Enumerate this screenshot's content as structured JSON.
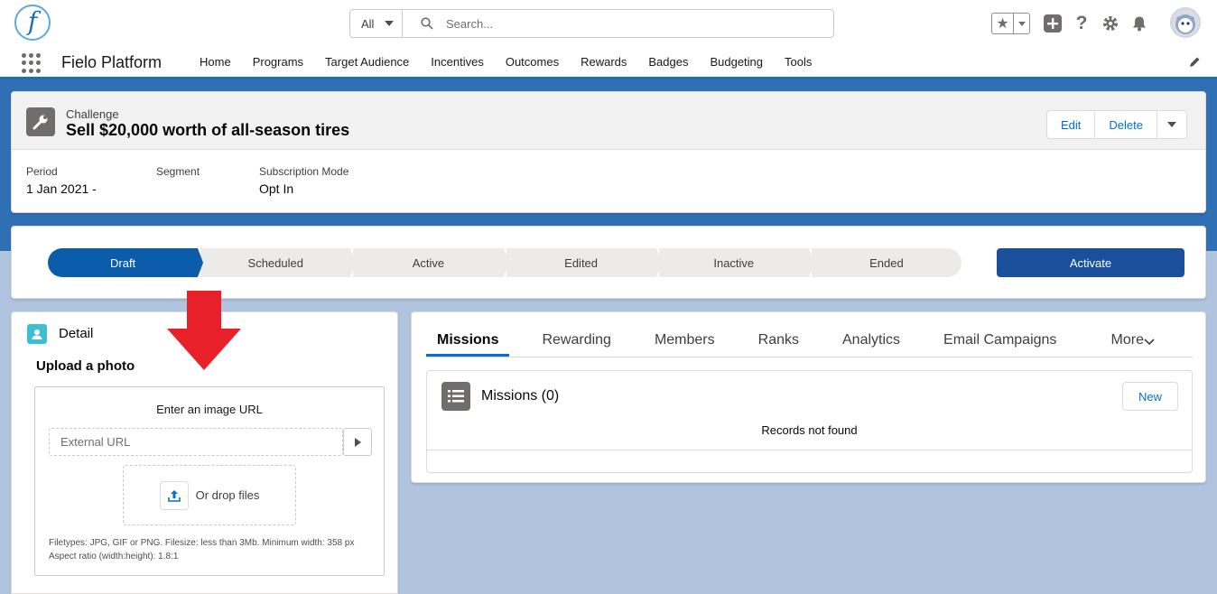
{
  "header": {
    "logo_letter": "f",
    "search": {
      "scope": "All",
      "placeholder": "Search..."
    }
  },
  "nav": {
    "app_name": "Fielo Platform",
    "items": [
      "Home",
      "Programs",
      "Target Audience",
      "Incentives",
      "Outcomes",
      "Rewards",
      "Badges",
      "Budgeting",
      "Tools"
    ]
  },
  "record": {
    "type": "Challenge",
    "title": "Sell $20,000 worth of all-season tires",
    "actions": {
      "edit": "Edit",
      "delete": "Delete"
    },
    "fields": [
      {
        "label": "Period",
        "value": "1 Jan 2021 -"
      },
      {
        "label": "Segment",
        "value": ""
      },
      {
        "label": "Subscription Mode",
        "value": "Opt In"
      }
    ]
  },
  "path": {
    "steps": [
      "Draft",
      "Scheduled",
      "Active",
      "Edited",
      "Inactive",
      "Ended"
    ],
    "current": "Draft",
    "action": "Activate"
  },
  "detail": {
    "title": "Detail",
    "upload_title": "Upload a photo",
    "enter_url": "Enter an image URL",
    "url_placeholder": "External URL",
    "drop_label": "Or drop files",
    "hint_line1": "Filetypes: JPG, GIF or PNG. Filesize: less than 3Mb. Minimum width: 358 px",
    "hint_line2": "Aspect ratio (width:height): 1.8:1"
  },
  "tabs": {
    "items": [
      "Missions",
      "Rewarding",
      "Members",
      "Ranks",
      "Analytics",
      "Email Campaigns"
    ],
    "more": "More",
    "active": "Missions"
  },
  "missions": {
    "title": "Missions (0)",
    "new_label": "New",
    "empty": "Records not found"
  },
  "colors": {
    "brand": "#1b6fb5",
    "path_active": "#0b5cab",
    "activate_button": "#1a4f9c",
    "link": "#0070d2",
    "arrow": "#e8202a"
  }
}
